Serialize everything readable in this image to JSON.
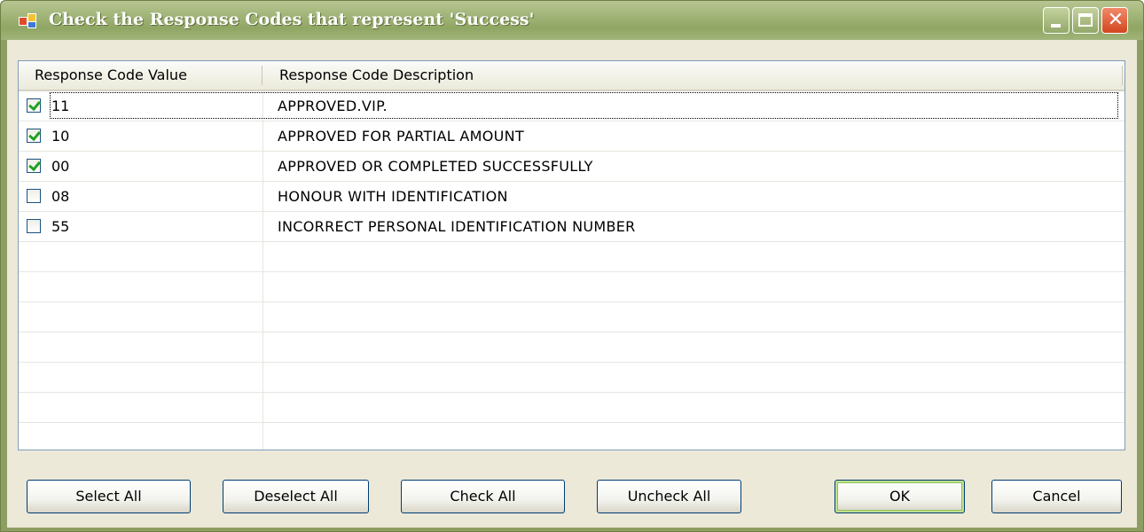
{
  "window": {
    "title": "Check the Response Codes that represent 'Success'"
  },
  "titlebar_buttons": {
    "minimize": "minimize",
    "maximize": "maximize",
    "close": "✕"
  },
  "grid": {
    "columns": [
      "Response Code Value",
      "Response Code Description"
    ],
    "rows": [
      {
        "checked": true,
        "code": "11",
        "description": "APPROVED.VIP."
      },
      {
        "checked": true,
        "code": "10",
        "description": "APPROVED FOR PARTIAL AMOUNT"
      },
      {
        "checked": true,
        "code": "00",
        "description": "APPROVED OR COMPLETED SUCCESSFULLY"
      },
      {
        "checked": false,
        "code": "08",
        "description": "HONOUR WITH IDENTIFICATION"
      },
      {
        "checked": false,
        "code": "55",
        "description": "INCORRECT PERSONAL IDENTIFICATION NUMBER"
      }
    ]
  },
  "buttons": {
    "select_all": "Select All",
    "deselect_all": "Deselect All",
    "check_all": "Check All",
    "uncheck_all": "Uncheck All",
    "ok": "OK",
    "cancel": "Cancel"
  }
}
